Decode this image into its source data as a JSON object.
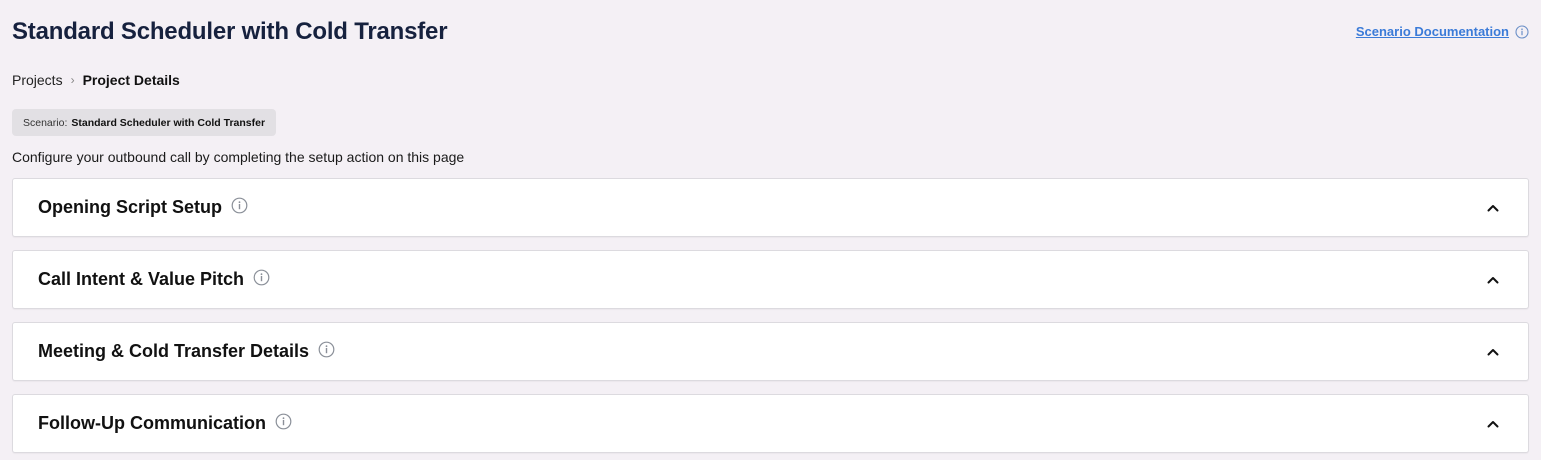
{
  "header": {
    "title": "Standard Scheduler with Cold Transfer",
    "doc_link": "Scenario Documentation"
  },
  "breadcrumb": {
    "parent": "Projects",
    "current": "Project Details"
  },
  "scenario": {
    "label": "Scenario:",
    "value": "Standard Scheduler with Cold Transfer"
  },
  "instructions": "Configure your outbound call by completing the setup action on this page",
  "sections": [
    {
      "title": "Opening Script Setup",
      "icon": "info-icon",
      "expanded_icon": "chevron-up-icon"
    },
    {
      "title": "Call Intent & Value Pitch",
      "icon": "info-icon",
      "expanded_icon": "chevron-up-icon"
    },
    {
      "title": "Meeting & Cold Transfer Details",
      "icon": "info-icon",
      "expanded_icon": "chevron-up-icon"
    },
    {
      "title": "Follow-Up Communication",
      "icon": "info-icon",
      "expanded_icon": "chevron-up-icon"
    }
  ],
  "colors": {
    "background": "#f4f0f5",
    "title": "#16213e",
    "link": "#3b7bd8",
    "chip": "#e2e0e4"
  }
}
